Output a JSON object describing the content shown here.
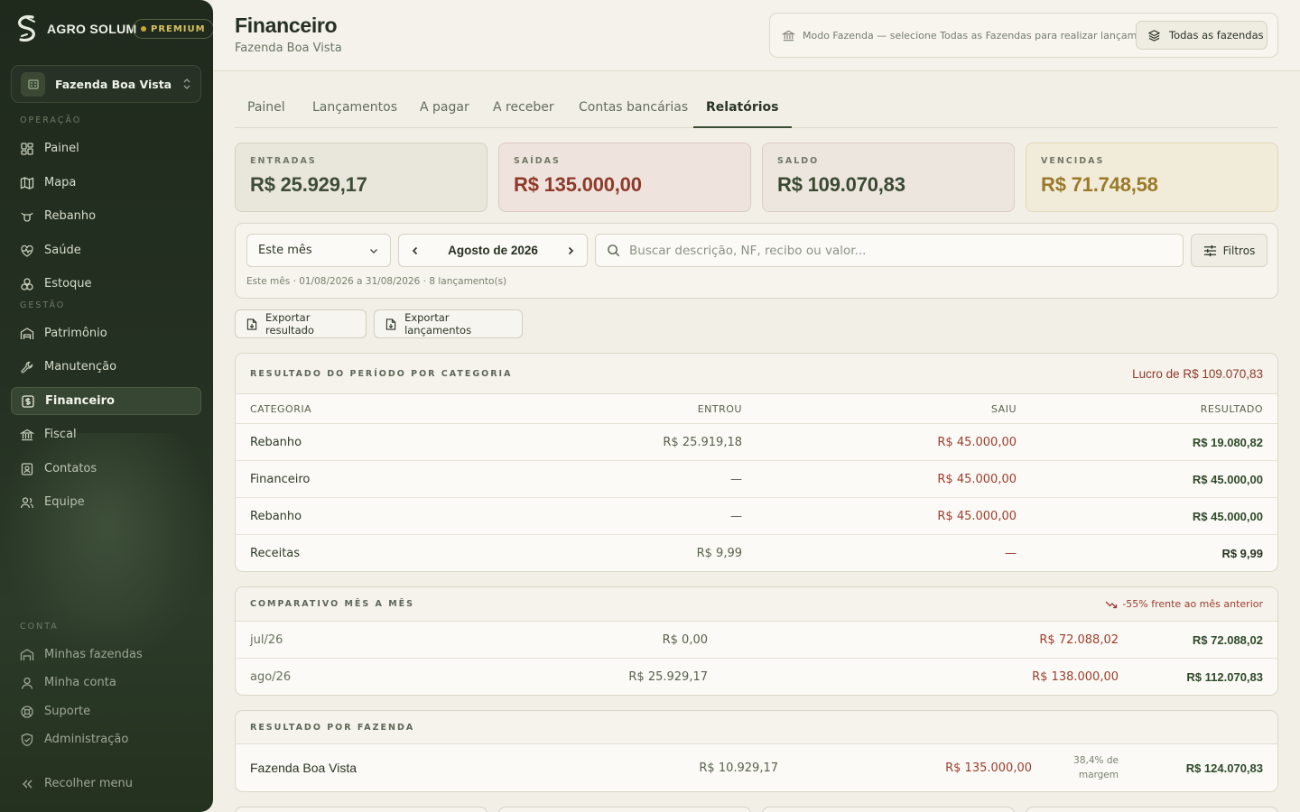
{
  "brand": {
    "name": "AGRO SOLUM",
    "badge": "PREMIUM"
  },
  "farm_selector": {
    "value": "Fazenda Boa Vista"
  },
  "sidebar": {
    "section_operacao": "OPERAÇÃO",
    "section_gestao": "GESTÃO",
    "section_conta": "CONTA",
    "operacao": [
      "Painel",
      "Mapa",
      "Rebanho",
      "Saúde",
      "Estoque"
    ],
    "gestao": [
      "Patrimônio",
      "Manutenção",
      "Financeiro",
      "Fiscal",
      "Contatos",
      "Equipe"
    ],
    "conta": [
      "Minhas fazendas",
      "Minha conta",
      "Suporte",
      "Administração"
    ],
    "collapse": "Recolher menu"
  },
  "header": {
    "title": "Financeiro",
    "subtitle": "Fazenda Boa Vista",
    "mode_text": "Modo Fazenda — selecione Todas as Fazendas para realizar lançamento",
    "all_farms_button": "Todas as fazendas"
  },
  "tabs": [
    "Painel",
    "Lançamentos",
    "A pagar",
    "A receber",
    "Contas bancárias",
    "Relatórios"
  ],
  "kpis": [
    {
      "label": "ENTRADAS",
      "value": "R$ 25.929,17",
      "color": "#3f4c37"
    },
    {
      "label": "SAÍDAS",
      "value": "R$ 135.000,00",
      "color": "#8e3a2a"
    },
    {
      "label": "SALDO",
      "value": "R$ 109.070,83",
      "color": "#3a4a32"
    },
    {
      "label": "VENCIDAS",
      "value": "R$ 71.748,58",
      "color": "#9a7a2a"
    }
  ],
  "filters": {
    "period": "Este mês",
    "month": "Agosto de 2026",
    "search_placeholder": "Buscar descrição, NF, recibo ou valor...",
    "filters_button": "Filtros",
    "range_text": "Este mês · 01/08/2026 a 31/08/2026 · 8 lançamento(s)"
  },
  "exports": {
    "result": "Exportar resultado",
    "entries": "Exportar lançamentos"
  },
  "by_category": {
    "title": "RESULTADO DO PERÍODO POR CATEGORIA",
    "profit": "Lucro de R$ 109.070,83",
    "headers": {
      "category": "CATEGORIA",
      "in": "ENTROU",
      "out": "SAIU",
      "result": "RESULTADO"
    },
    "rows": [
      {
        "category": "Rebanho",
        "in": "R$ 25.919,18",
        "out": "R$ 45.000,00",
        "result": "R$ 19.080,82"
      },
      {
        "category": "Financeiro",
        "in": "—",
        "out": "R$ 45.000,00",
        "result": "R$ 45.000,00"
      },
      {
        "category": "Rebanho",
        "in": "—",
        "out": "R$ 45.000,00",
        "result": "R$ 45.000,00"
      },
      {
        "category": "Receitas",
        "in": "R$ 9,99",
        "out": "—",
        "result": "R$ 9,99"
      }
    ]
  },
  "monthly": {
    "title": "COMPARATIVO MÊS A MÊS",
    "change": "-55% frente ao mês anterior",
    "rows": [
      {
        "month": "jul/26",
        "in": "R$ 0,00",
        "out": "R$ 72.088,02",
        "result": "R$ 72.088,02"
      },
      {
        "month": "ago/26",
        "in": "R$ 25.929,17",
        "out": "R$ 138.000,00",
        "result": "R$ 112.070,83"
      }
    ]
  },
  "by_farm": {
    "title": "RESULTADO POR FAZENDA",
    "rows": [
      {
        "farm": "Fazenda Boa Vista",
        "in": "R$ 10.929,17",
        "out": "R$ 135.000,00",
        "margin_pct": "38,4% de",
        "margin_label": "margem",
        "result": "R$ 124.070,83"
      }
    ]
  }
}
